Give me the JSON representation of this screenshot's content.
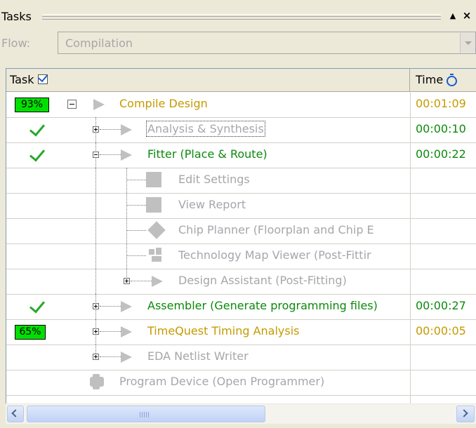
{
  "panel": {
    "title": "Tasks",
    "flow_label": "Flow:",
    "flow_value": "Compilation"
  },
  "columns": {
    "task": "Task",
    "time": "Time"
  },
  "rows": [
    {
      "label": "Compile Design",
      "time": "00:01:09",
      "status": "93%",
      "progress": 0.93,
      "color": "#c59a00"
    },
    {
      "label": "Analysis & Synthesis",
      "time": "00:00:10",
      "status": "check",
      "color": "#a7a6aa"
    },
    {
      "label": "Fitter (Place & Route)",
      "time": "00:00:22",
      "status": "check",
      "color": "#0b8a0b"
    },
    {
      "label": "Edit Settings",
      "time": "",
      "icon": "settings-icon"
    },
    {
      "label": "View Report",
      "time": "",
      "icon": "report-icon"
    },
    {
      "label": "Chip Planner (Floorplan and Chip E",
      "time": "",
      "icon": "chip-planner-icon"
    },
    {
      "label": "Technology Map Viewer (Post-Fittir",
      "time": "",
      "icon": "tech-map-icon"
    },
    {
      "label": "Design Assistant (Post-Fitting)",
      "time": ""
    },
    {
      "label": "Assembler (Generate programming files)",
      "time": "00:00:27",
      "status": "check",
      "color": "#0b8a0b"
    },
    {
      "label": "TimeQuest Timing Analysis",
      "time": "00:00:05",
      "status": "65%",
      "progress": 0.65,
      "color": "#c59a00"
    },
    {
      "label": "EDA Netlist Writer",
      "time": ""
    },
    {
      "label": "Program Device (Open Programmer)",
      "time": "",
      "icon": "programmer-icon"
    }
  ],
  "accent": {
    "badge_green": "#00e000",
    "check_green": "#28a828",
    "running_orange": "#c59a00",
    "done_green": "#0b8a0b",
    "disabled_gray": "#a7a6aa"
  }
}
